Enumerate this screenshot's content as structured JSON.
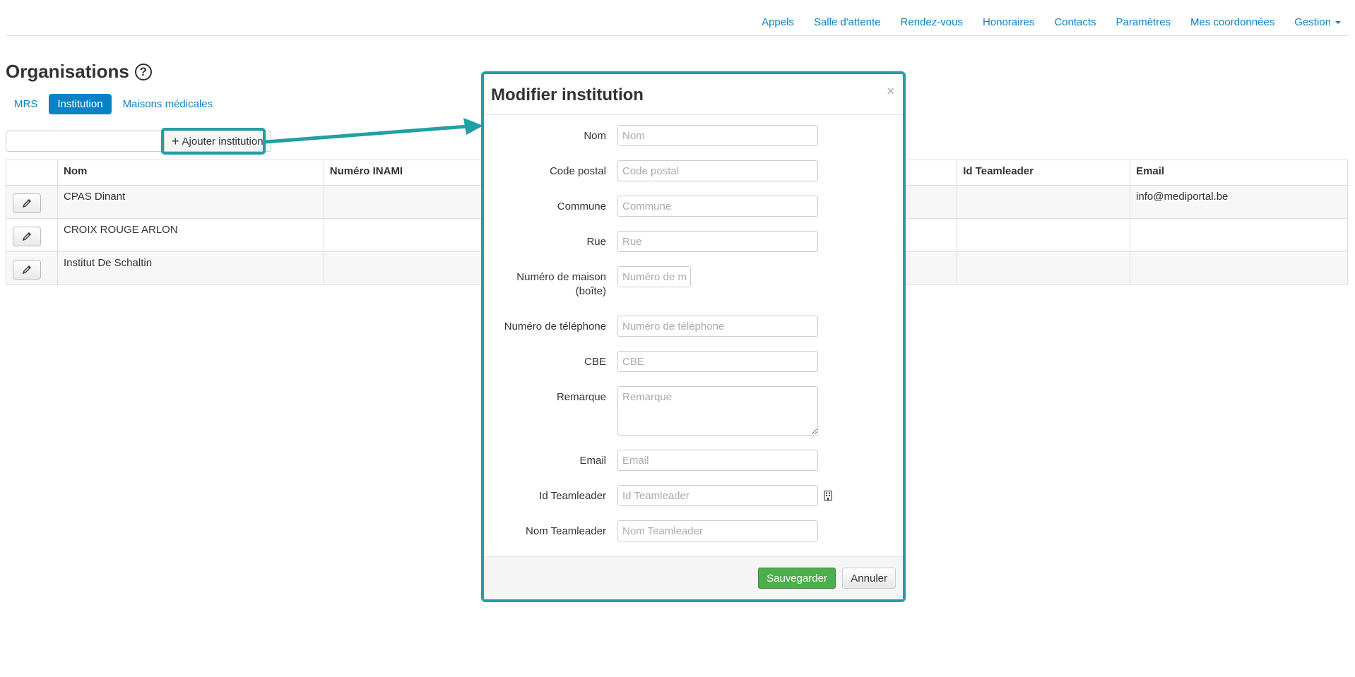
{
  "nav": {
    "items": [
      "Appels",
      "Salle d'attente",
      "Rendez-vous",
      "Honoraires",
      "Contacts",
      "Paramètres",
      "Mes coordonnées",
      "Gestion"
    ]
  },
  "page": {
    "title": "Organisations",
    "help": "?"
  },
  "tabs": [
    "MRS",
    "Institution",
    "Maisons médicales"
  ],
  "toolbar": {
    "add_label": "Ajouter institution",
    "add_symbol": "+"
  },
  "table": {
    "headers": [
      "",
      "Nom",
      "Numéro INAMI",
      "Id Teamleader",
      "Email"
    ],
    "rows": [
      {
        "nom": "CPAS Dinant",
        "inami": "",
        "teamleader": "",
        "email": "info@mediportal.be"
      },
      {
        "nom": "CROIX ROUGE ARLON",
        "inami": "",
        "teamleader": "",
        "email": ""
      },
      {
        "nom": "Institut De Schaltin",
        "inami": "",
        "teamleader": "",
        "email": ""
      }
    ]
  },
  "modal": {
    "title": "Modifier institution",
    "close": "×",
    "fields": {
      "nom": {
        "label": "Nom",
        "placeholder": "Nom"
      },
      "code_postal": {
        "label": "Code postal",
        "placeholder": "Code postal"
      },
      "commune": {
        "label": "Commune",
        "placeholder": "Commune"
      },
      "rue": {
        "label": "Rue",
        "placeholder": "Rue"
      },
      "numero_maison": {
        "label_line1": "Numéro de maison",
        "label_line2": "(boîte)",
        "placeholder": "Numéro de maison"
      },
      "telephone": {
        "label": "Numéro de téléphone",
        "placeholder": "Numéro de téléphone"
      },
      "cbe": {
        "label": "CBE",
        "placeholder": "CBE"
      },
      "remarque": {
        "label": "Remarque",
        "placeholder": "Remarque"
      },
      "email": {
        "label": "Email",
        "placeholder": "Email"
      },
      "id_teamleader": {
        "label": "Id Teamleader",
        "placeholder": "Id Teamleader"
      },
      "nom_teamleader": {
        "label": "Nom Teamleader",
        "placeholder": "Nom Teamleader"
      }
    },
    "save_label": "Sauvegarder",
    "cancel_label": "Annuler"
  },
  "colors": {
    "link": "#0a83c6",
    "highlight": "#20a0a4",
    "save": "#4cae4c"
  }
}
